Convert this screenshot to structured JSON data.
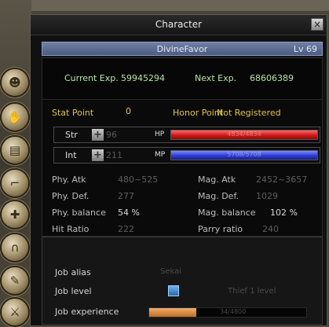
{
  "window": {
    "title": "Character",
    "close_icon": "×"
  },
  "character": {
    "name": "DivineFavor",
    "level": "Lv 69"
  },
  "experience": {
    "current_label": "Current Exp.",
    "current_value": "59945294",
    "next_label": "Next Exp.",
    "next_value": "68606389"
  },
  "stat_point": {
    "label": "Stat Point",
    "value": "0"
  },
  "honor_point": {
    "label": "Honor Point",
    "value": "Not Registered"
  },
  "str": {
    "label": "Str",
    "value": "96"
  },
  "int": {
    "label": "Int",
    "value": "211"
  },
  "hp": {
    "label": "HP",
    "text": "4834/4834",
    "fill": 1.0,
    "color": "#d01818"
  },
  "mp": {
    "label": "MP",
    "text": "5708/5708",
    "fill": 1.0,
    "color": "#2d3cd8"
  },
  "attributes": {
    "phy_atk": {
      "label": "Phy. Atk",
      "value": "480~525"
    },
    "phy_def": {
      "label": "Phy. Def.",
      "value": "277"
    },
    "phy_balance": {
      "label": "Phy. balance",
      "value": "54 %"
    },
    "hit_ratio": {
      "label": "Hit Ratio",
      "value": "222"
    },
    "mag_atk": {
      "label": "Mag. Atk",
      "value": "2452~3657"
    },
    "mag_def": {
      "label": "Mag. Def.",
      "value": "1029"
    },
    "mag_balance": {
      "label": "Mag. balance",
      "value": "102 %"
    },
    "parry_ratio": {
      "label": "Parry ratio",
      "value": "240"
    }
  },
  "job": {
    "alias_label": "Job alias",
    "alias_value": "Sekai",
    "level_label": "Job level",
    "level_value": "Thief 1 level",
    "experience_label": "Job experience",
    "experience_fill": 0.3,
    "experience_value": "34/4800"
  },
  "side_icons": [
    "head-icon",
    "hand-icon",
    "book-icon",
    "leg-icon",
    "handshake-icon",
    "feet-icon",
    "scroll-icon",
    "weapon-icon"
  ]
}
